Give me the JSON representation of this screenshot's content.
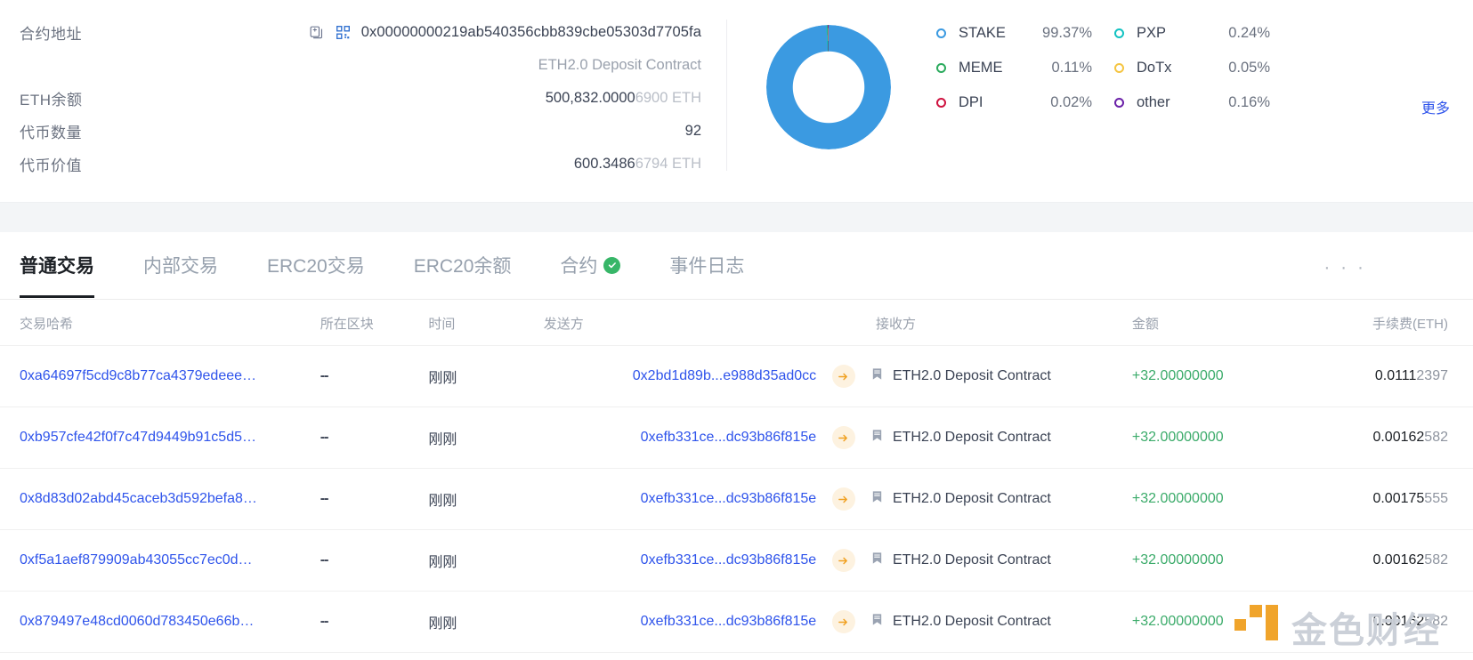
{
  "summary": {
    "rows": [
      {
        "label": "合约地址",
        "value": "0x00000000219ab540356cbb839cbe05303d7705fa"
      },
      {
        "label": "",
        "value": "ETH2.0 Deposit Contract"
      },
      {
        "label": "ETH余额",
        "value_main": "500,832.0000",
        "value_tail": "6900",
        "unit": "ETH"
      },
      {
        "label": "代币数量",
        "value": "92"
      },
      {
        "label": "代币价值",
        "value_main": "600.3486",
        "value_tail": "6794",
        "unit": "ETH"
      }
    ],
    "copy_icon": "copy-icon",
    "qr_icon": "qr-code-icon"
  },
  "chart_data": {
    "type": "pie",
    "title": "",
    "legend_position": "right",
    "labels": [
      "STAKE",
      "PXP",
      "MEME",
      "DoTx",
      "DPI",
      "other"
    ],
    "values": [
      99.37,
      0.24,
      0.11,
      0.05,
      0.02,
      0.16
    ],
    "value_labels": [
      "99.37%",
      "0.24%",
      "0.11%",
      "0.05%",
      "0.02%",
      "0.16%"
    ],
    "colors": [
      "#3b9ae1",
      "#13c2c2",
      "#2cab5e",
      "#f5c542",
      "#cf1340",
      "#6b21a8"
    ],
    "donut": true,
    "more_label": "更多"
  },
  "tabs": [
    {
      "label": "普通交易",
      "active": true,
      "badge": null
    },
    {
      "label": "内部交易",
      "active": false,
      "badge": null
    },
    {
      "label": "ERC20交易",
      "active": false,
      "badge": null
    },
    {
      "label": "ERC20余额",
      "active": false,
      "badge": null
    },
    {
      "label": "合约",
      "active": false,
      "badge": "check"
    },
    {
      "label": "事件日志",
      "active": false,
      "badge": null
    }
  ],
  "tabs_overflow": "· · ·",
  "table": {
    "headers": {
      "hash": "交易哈希",
      "block": "所在区块",
      "time": "时间",
      "from": "发送方",
      "to": "接收方",
      "amount": "金额",
      "fee": "手续费(ETH)"
    },
    "rows": [
      {
        "hash": "0xa64697f5cd9c8b77ca4379edeee…",
        "block": "--",
        "time": "刚刚",
        "from": "0x2bd1d89b...e988d35ad0cc",
        "to": "ETH2.0 Deposit Contract",
        "amount": "+32.00000000",
        "fee_main": "0.0111",
        "fee_tail": "2397"
      },
      {
        "hash": "0xb957cfe42f0f7c47d9449b91c5d5…",
        "block": "--",
        "time": "刚刚",
        "from": "0xefb331ce...dc93b86f815e",
        "to": "ETH2.0 Deposit Contract",
        "amount": "+32.00000000",
        "fee_main": "0.00162",
        "fee_tail": "582"
      },
      {
        "hash": "0x8d83d02abd45caceb3d592befa8…",
        "block": "--",
        "time": "刚刚",
        "from": "0xefb331ce...dc93b86f815e",
        "to": "ETH2.0 Deposit Contract",
        "amount": "+32.00000000",
        "fee_main": "0.00175",
        "fee_tail": "555"
      },
      {
        "hash": "0xf5a1aef879909ab43055cc7ec0d…",
        "block": "--",
        "time": "刚刚",
        "from": "0xefb331ce...dc93b86f815e",
        "to": "ETH2.0 Deposit Contract",
        "amount": "+32.00000000",
        "fee_main": "0.00162",
        "fee_tail": "582"
      },
      {
        "hash": "0x879497e48cd0060d783450e66b…",
        "block": "--",
        "time": "刚刚",
        "from": "0xefb331ce...dc93b86f815e",
        "to": "ETH2.0 Deposit Contract",
        "amount": "+32.00000000",
        "fee_main": "0.00162",
        "fee_tail": "582"
      }
    ]
  },
  "watermark": {
    "text": "金色财经"
  },
  "colors": {
    "link": "#2f54eb",
    "positive": "#3bab6a",
    "accent_blue": "#3b9ae1",
    "tab_active": "#1b1f24"
  }
}
